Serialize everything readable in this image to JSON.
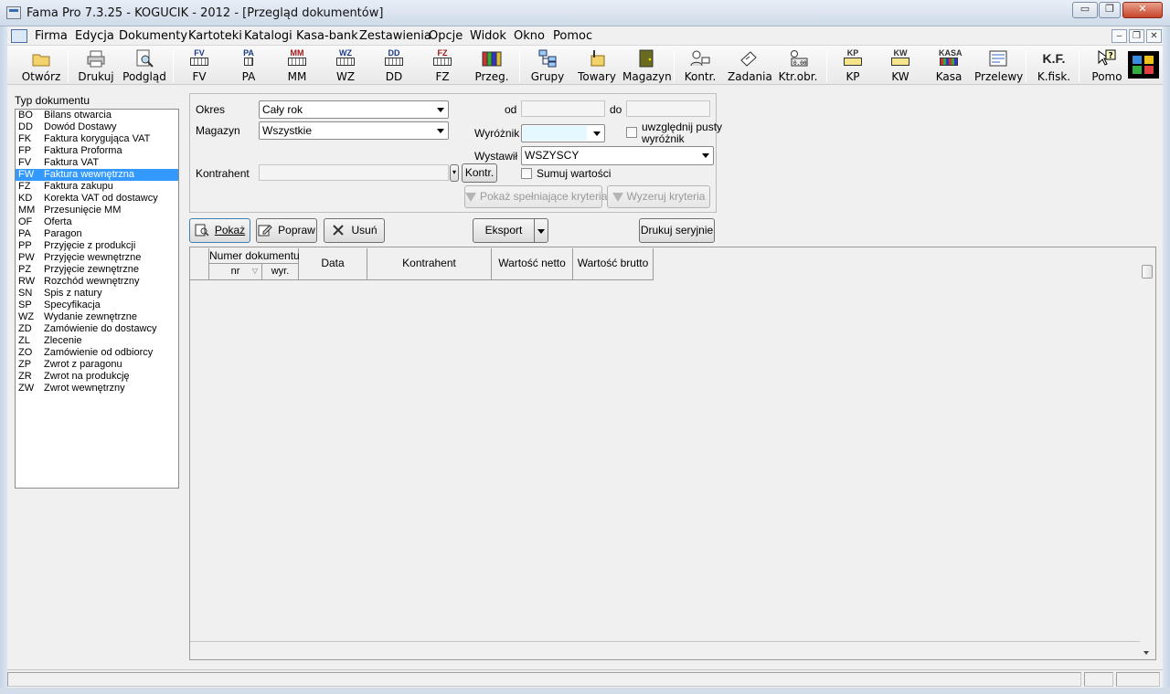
{
  "window": {
    "title": "Fama Pro 7.3.25 - KOGUCIK - 2012 - [Przegląd dokumentów]",
    "min_label": "▭",
    "max_label": "❐",
    "close_label": "✕"
  },
  "menu": {
    "items": [
      "Firma",
      "Edycja",
      "Dokumenty",
      "Kartoteki",
      "Katalogi",
      "Kasa-bank",
      "Zestawienia",
      "Opcje",
      "Widok",
      "Okno",
      "Pomoc"
    ],
    "mdi_min": "–",
    "mdi_restore": "❐",
    "mdi_close": "✕"
  },
  "toolbar": {
    "buttons": [
      {
        "label": "Otwórz",
        "icon": "folder-icon"
      },
      {
        "label": "Drukuj",
        "icon": "printer-icon"
      },
      {
        "label": "Podgląd",
        "icon": "preview-icon"
      },
      {
        "label": "FV",
        "icon": "doc-fv-icon",
        "code": "FV"
      },
      {
        "label": "PA",
        "icon": "doc-pa-icon",
        "code": "PA"
      },
      {
        "label": "MM",
        "icon": "doc-mm-icon",
        "code": "MM"
      },
      {
        "label": "WZ",
        "icon": "doc-wz-icon",
        "code": "WZ"
      },
      {
        "label": "DD",
        "icon": "doc-dd-icon",
        "code": "DD"
      },
      {
        "label": "FZ",
        "icon": "doc-fz-icon",
        "code": "FZ"
      },
      {
        "label": "Przeg.",
        "icon": "binders-icon"
      },
      {
        "label": "Grupy",
        "icon": "groups-icon"
      },
      {
        "label": "Towary",
        "icon": "goods-icon"
      },
      {
        "label": "Magazyn",
        "icon": "warehouse-icon"
      },
      {
        "label": "Kontr.",
        "icon": "contractors-icon"
      },
      {
        "label": "Zadania",
        "icon": "tasks-icon"
      },
      {
        "label": "Ktr.obr.",
        "icon": "turnover-icon"
      },
      {
        "label": "KP",
        "icon": "cash-in-icon",
        "code": "KP"
      },
      {
        "label": "KW",
        "icon": "cash-out-icon",
        "code": "KW"
      },
      {
        "label": "Kasa",
        "icon": "cash-register-icon",
        "code": "KASA"
      },
      {
        "label": "Przelewy",
        "icon": "transfers-icon"
      },
      {
        "label": "K.fisk.",
        "icon": "fiscal-icon",
        "code": "K.F."
      },
      {
        "label": "Pomo",
        "icon": "help-icon"
      }
    ]
  },
  "doctypes": {
    "label": "Typ dokumentu",
    "selected_index": 4,
    "items": [
      {
        "code": "BO",
        "name": "Bilans otwarcia"
      },
      {
        "code": "DD",
        "name": "Dowód Dostawy"
      },
      {
        "code": "FK",
        "name": "Faktura korygująca VAT"
      },
      {
        "code": "FP",
        "name": "Faktura Proforma"
      },
      {
        "code": "FV",
        "name": "Faktura VAT"
      },
      {
        "code": "FW",
        "name": "Faktura wewnętrzna"
      },
      {
        "code": "FZ",
        "name": "Faktura zakupu"
      },
      {
        "code": "KD",
        "name": "Korekta VAT od dostawcy"
      },
      {
        "code": "MM",
        "name": "Przesunięcie MM"
      },
      {
        "code": "OF",
        "name": "Oferta"
      },
      {
        "code": "PA",
        "name": "Paragon"
      },
      {
        "code": "PP",
        "name": "Przyjęcie z produkcji"
      },
      {
        "code": "PW",
        "name": "Przyjęcie wewnętrzne"
      },
      {
        "code": "PZ",
        "name": "Przyjęcie zewnętrzne"
      },
      {
        "code": "RW",
        "name": "Rozchód wewnętrzny"
      },
      {
        "code": "SN",
        "name": "Spis z natury"
      },
      {
        "code": "SP",
        "name": "Specyfikacja"
      },
      {
        "code": "WZ",
        "name": "Wydanie zewnętrzne"
      },
      {
        "code": "ZD",
        "name": "Zamówienie do dostawcy"
      },
      {
        "code": "ZL",
        "name": "Zlecenie"
      },
      {
        "code": "ZO",
        "name": "Zamówienie od odbiorcy"
      },
      {
        "code": "ZP",
        "name": "Zwrot z paragonu"
      },
      {
        "code": "ZR",
        "name": "Zwrot na produkcję"
      },
      {
        "code": "ZW",
        "name": "Zwrot wewnętrzny"
      }
    ]
  },
  "filters": {
    "okres_label": "Okres",
    "okres_value": "Cały rok",
    "magazyn_label": "Magazyn",
    "magazyn_value": "Wszystkie",
    "od_label": "od",
    "do_label": "do",
    "wyroznik_label": "Wyróżnik",
    "wyroznik_value": "",
    "uwzglednij_label_1": "uwzględnij pusty",
    "uwzglednij_label_2": "wyróżnik",
    "wystawil_label": "Wystawił",
    "wystawil_value": "WSZYSCY",
    "kontrahent_label": "Kontrahent",
    "kontrahent_value": "",
    "kontr_button": "Kontr.",
    "sumuj_label": "Sumuj wartości",
    "pokaz_kryteria_button": "Pokaż spełniające kryteria",
    "wyzeruj_button": "Wyzeruj kryteria"
  },
  "actions": {
    "pokaz": "Pokaż",
    "popraw": "Popraw",
    "usun": "Usuń",
    "eksport": "Eksport",
    "drukuj_seryjnie": "Drukuj seryjnie"
  },
  "grid": {
    "numer_dokumentu": "Numer dokumentu",
    "nr": "nr",
    "wyr": "wyr.",
    "data": "Data",
    "kontrahent": "Kontrahent",
    "wartosc_netto": "Wartość netto",
    "wartosc_brutto": "Wartość brutto",
    "rows": []
  },
  "colors": {
    "selection": "#3399ff",
    "wyroznik_bg": "#e6f8ff"
  }
}
